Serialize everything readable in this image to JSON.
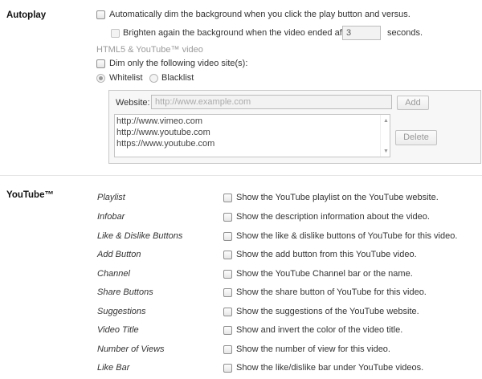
{
  "autoplay": {
    "title": "Autoplay",
    "dim_on_play": "Automatically dim the background when you click the play button and versus.",
    "brighten_before": "Brighten again the background when the video ended after",
    "brighten_value": "3",
    "brighten_after": "seconds.",
    "html5_note": "HTML5 & YouTube™ video",
    "dim_only": "Dim only the following video site(s):",
    "whitelist": "Whitelist",
    "blacklist": "Blacklist",
    "website_label": "Website:",
    "website_placeholder": "http://www.example.com",
    "add_button": "Add",
    "sites": [
      "http://www.vimeo.com",
      "http://www.youtube.com",
      "https://www.youtube.com"
    ],
    "delete_button": "Delete"
  },
  "youtube": {
    "title": "YouTube™",
    "options": [
      {
        "name": "Playlist",
        "desc": "Show the YouTube playlist on the YouTube website."
      },
      {
        "name": "Infobar",
        "desc": "Show the description information about the video."
      },
      {
        "name": "Like & Dislike Buttons",
        "desc": "Show the like & dislike buttons of YouTube for this video."
      },
      {
        "name": "Add Button",
        "desc": "Show the add button from this YouTube video."
      },
      {
        "name": "Channel",
        "desc": "Show the YouTube Channel bar or the name."
      },
      {
        "name": "Share Buttons",
        "desc": "Show the share button of YouTube for this video."
      },
      {
        "name": "Suggestions",
        "desc": "Show the suggestions of the YouTube website."
      },
      {
        "name": "Video Title",
        "desc": "Show and invert the color of the video title."
      },
      {
        "name": "Number of Views",
        "desc": "Show the number of view for this video."
      },
      {
        "name": "Like Bar",
        "desc": "Show the like/dislike bar under YouTube videos."
      }
    ]
  }
}
